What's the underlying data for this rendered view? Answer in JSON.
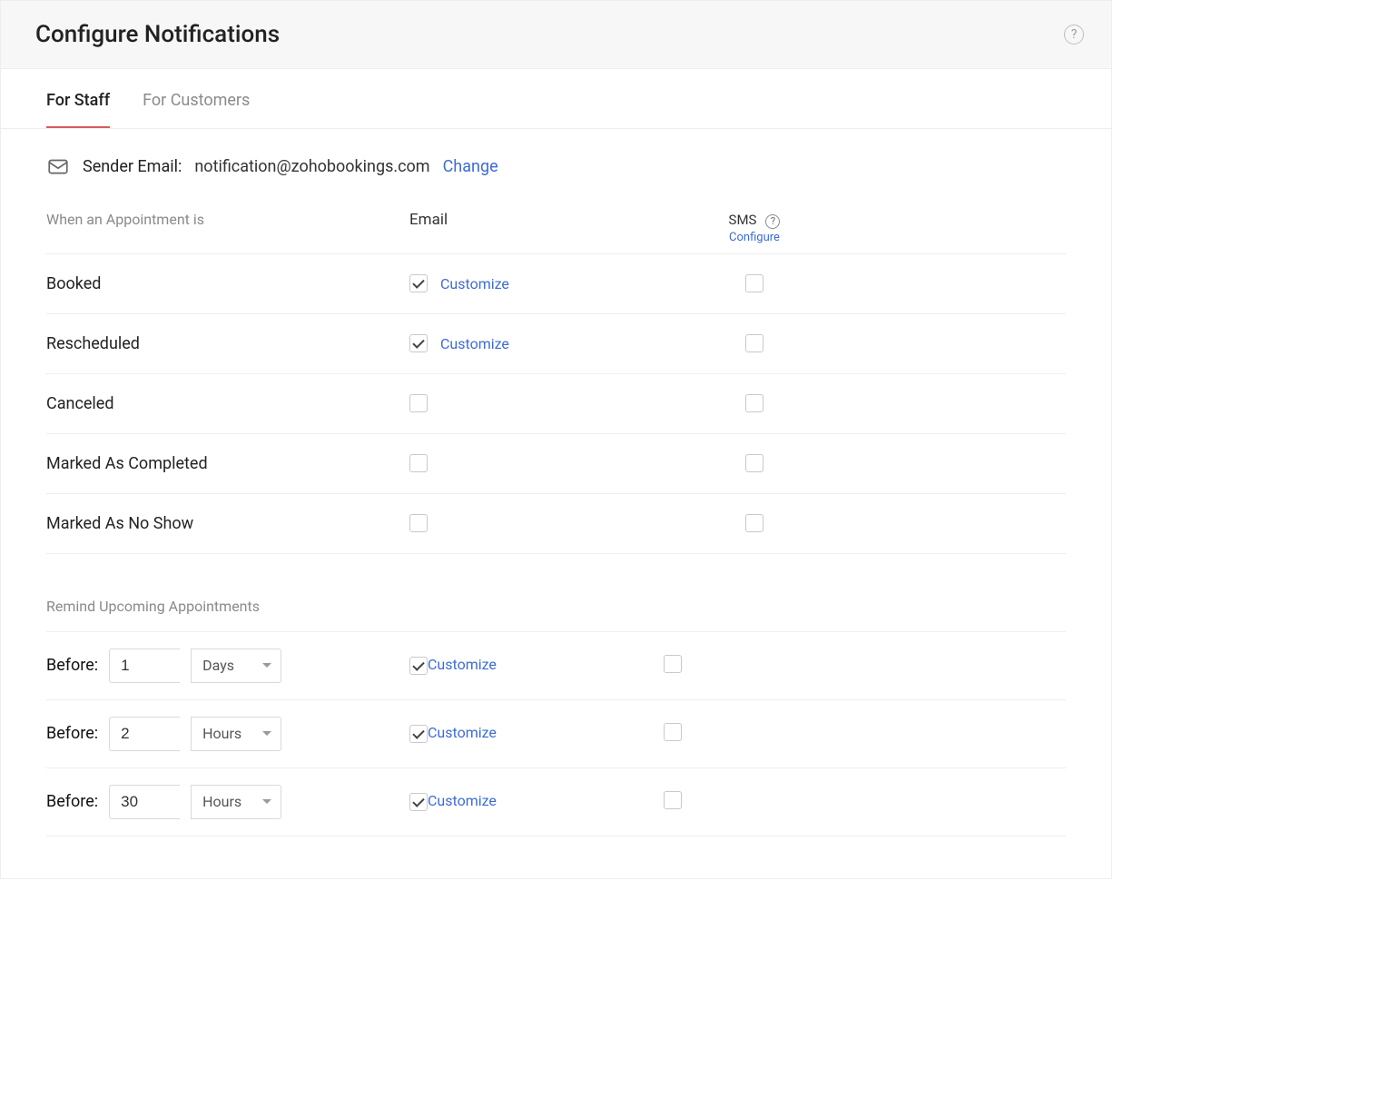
{
  "header": {
    "title": "Configure Notifications"
  },
  "tabs": [
    {
      "label": "For Staff",
      "active": true
    },
    {
      "label": "For Customers",
      "active": false
    }
  ],
  "sender": {
    "label": "Sender Email:",
    "email": "notification@zohobookings.com",
    "change_label": "Change"
  },
  "columns": {
    "appointment_label": "When an Appointment is",
    "email_label": "Email",
    "sms_label": "SMS",
    "sms_configure_label": "Configure"
  },
  "customize_label": "Customize",
  "events": [
    {
      "name": "Booked",
      "email_checked": true,
      "email_customize": true,
      "sms_checked": false
    },
    {
      "name": "Rescheduled",
      "email_checked": true,
      "email_customize": true,
      "sms_checked": false
    },
    {
      "name": "Canceled",
      "email_checked": false,
      "email_customize": false,
      "sms_checked": false
    },
    {
      "name": "Marked As Completed",
      "email_checked": false,
      "email_customize": false,
      "sms_checked": false
    },
    {
      "name": "Marked As No Show",
      "email_checked": false,
      "email_customize": false,
      "sms_checked": false
    }
  ],
  "reminders": {
    "section_label": "Remind Upcoming Appointments",
    "before_label": "Before:",
    "items": [
      {
        "value": "1",
        "unit": "Days",
        "email_checked": true,
        "sms_checked": false
      },
      {
        "value": "2",
        "unit": "Hours",
        "email_checked": true,
        "sms_checked": false
      },
      {
        "value": "30",
        "unit": "Hours",
        "email_checked": true,
        "sms_checked": false
      }
    ]
  }
}
